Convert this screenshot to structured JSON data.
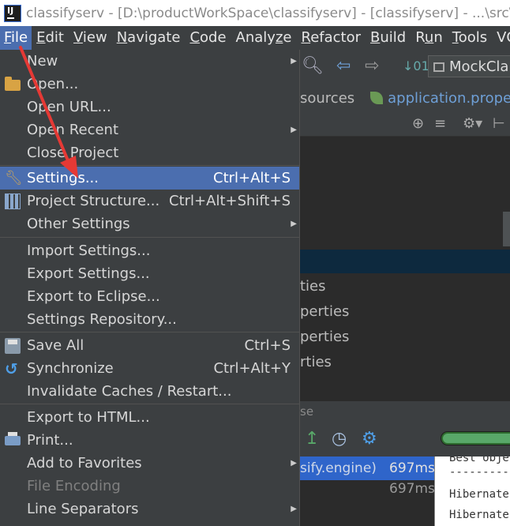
{
  "window": {
    "title": "classifyserv - [D:\\productWorkSpace\\classifyserv] - [classifyserv] - ...\\src\\m"
  },
  "menubar": {
    "items": [
      "File",
      "Edit",
      "View",
      "Navigate",
      "Code",
      "Analyze",
      "Refactor",
      "Build",
      "Run",
      "Tools",
      "VCS"
    ],
    "underline": [
      "F",
      "E",
      "V",
      "N",
      "C",
      "z",
      "R",
      "B",
      "u",
      "T",
      "S"
    ]
  },
  "toolbar": {
    "run_config": "MockCla"
  },
  "breadcrumbs": {
    "folder": "sources",
    "file": "application.proper"
  },
  "file_menu": {
    "new": "New",
    "open": "Open...",
    "open_url": "Open URL...",
    "open_recent": "Open Recent",
    "close_project": "Close Project",
    "settings": "Settings...",
    "settings_shortcut": "Ctrl+Alt+S",
    "project_structure": "Project Structure...",
    "project_structure_shortcut": "Ctrl+Alt+Shift+S",
    "other_settings": "Other Settings",
    "import_settings": "Import Settings...",
    "export_settings": "Export Settings...",
    "export_to_eclipse": "Export to Eclipse...",
    "settings_repository": "Settings Repository...",
    "save_all": "Save All",
    "save_all_shortcut": "Ctrl+S",
    "synchronize": "Synchronize",
    "synchronize_shortcut": "Ctrl+Alt+Y",
    "invalidate_caches": "Invalidate Caches / Restart...",
    "export_to_html": "Export to HTML...",
    "print": "Print...",
    "add_to_favorites": "Add to Favorites",
    "file_encoding": "File Encoding",
    "line_separators": "Line Separators"
  },
  "background": {
    "tree_rows": [
      "ties",
      "perties",
      "perties",
      "rties"
    ],
    "tab_hint": "se",
    "run_rows": [
      {
        "name": "sify.engine)",
        "time": "697ms"
      },
      {
        "name": "",
        "time": "697ms"
      }
    ],
    "console_lines": [
      "Best obje",
      "---------",
      "Hibernate",
      "Hibernate"
    ]
  },
  "colors": {
    "menu_bg": "#3c3f41",
    "highlight": "#4b6eaf",
    "annotation_arrow": "#e53935"
  }
}
